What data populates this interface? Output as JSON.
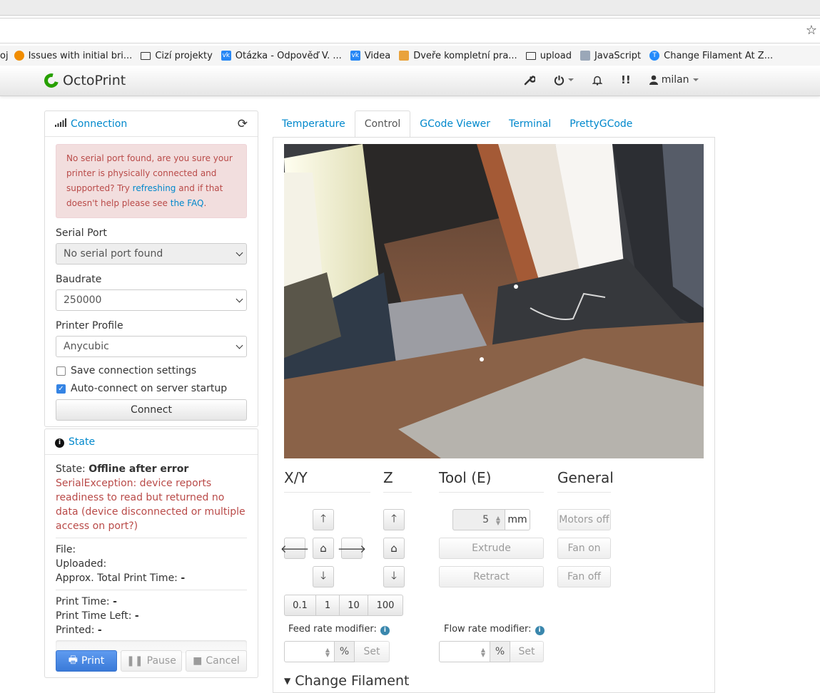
{
  "bookmarks": [
    {
      "label": "Issues with initial bri...",
      "icon": "github-icon"
    },
    {
      "label": "Cizí projekty",
      "icon": "folder-icon"
    },
    {
      "label": "Otázka - Odpověď V. ...",
      "icon": "vk-icon"
    },
    {
      "label": "Videa",
      "icon": "vk-icon"
    },
    {
      "label": "Dveře kompletní pra...",
      "icon": "site-icon"
    },
    {
      "label": "upload",
      "icon": "folder-icon"
    },
    {
      "label": "JavaScript",
      "icon": "js-icon"
    },
    {
      "label": "Change Filament At Z...",
      "icon": "thingiverse-icon"
    }
  ],
  "navbar": {
    "brand": "OctoPrint",
    "user": "milan"
  },
  "connection": {
    "title": "Connection",
    "alert_part1": "No serial port found, are you sure your printer is physically connected and supported? Try ",
    "alert_link1": "refreshing",
    "alert_part2": " and if that doesn't help please see ",
    "alert_link2": "the FAQ",
    "alert_part3": ".",
    "serial_port_label": "Serial Port",
    "serial_port_value": "No serial port found",
    "baudrate_label": "Baudrate",
    "baudrate_value": "250000",
    "profile_label": "Printer Profile",
    "profile_value": "Anycubic",
    "save_label": "Save connection settings",
    "autoconnect_label": "Auto-connect on server startup",
    "connect_button": "Connect"
  },
  "state": {
    "title": "State",
    "state_label": "State:",
    "state_value": "Offline after error",
    "error": "SerialException: device reports readiness to read but returned no data (device disconnected or multiple access on port?)",
    "file_label": "File:",
    "uploaded_label": "Uploaded:",
    "approx_label": "Approx. Total Print Time:",
    "approx_value": "-",
    "print_time_label": "Print Time:",
    "print_time_value": "-",
    "time_left_label": "Print Time Left:",
    "time_left_value": "-",
    "printed_label": "Printed:",
    "printed_value": "-",
    "print_button": "Print",
    "pause_button": "Pause",
    "cancel_button": "Cancel"
  },
  "tabs": [
    "Temperature",
    "Control",
    "GCode Viewer",
    "Terminal",
    "PrettyGCode"
  ],
  "control": {
    "xy_heading": "X/Y",
    "z_heading": "Z",
    "tool_heading": "Tool (E)",
    "general_heading": "General",
    "step_sizes": [
      "0.1",
      "1",
      "10",
      "100"
    ],
    "extrude_amount": "5",
    "unit": "mm",
    "extrude_button": "Extrude",
    "retract_button": "Retract",
    "motors_off": "Motors off",
    "fan_on": "Fan on",
    "fan_off": "Fan off",
    "feed_rate_label": "Feed rate modifier:",
    "flow_rate_label": "Flow rate modifier:",
    "percent": "%",
    "set_button": "Set",
    "change_filament": "Change Filament"
  },
  "colors": {
    "link": "#0088cc",
    "error": "#b94a48",
    "primary": "#3a7ad8"
  }
}
